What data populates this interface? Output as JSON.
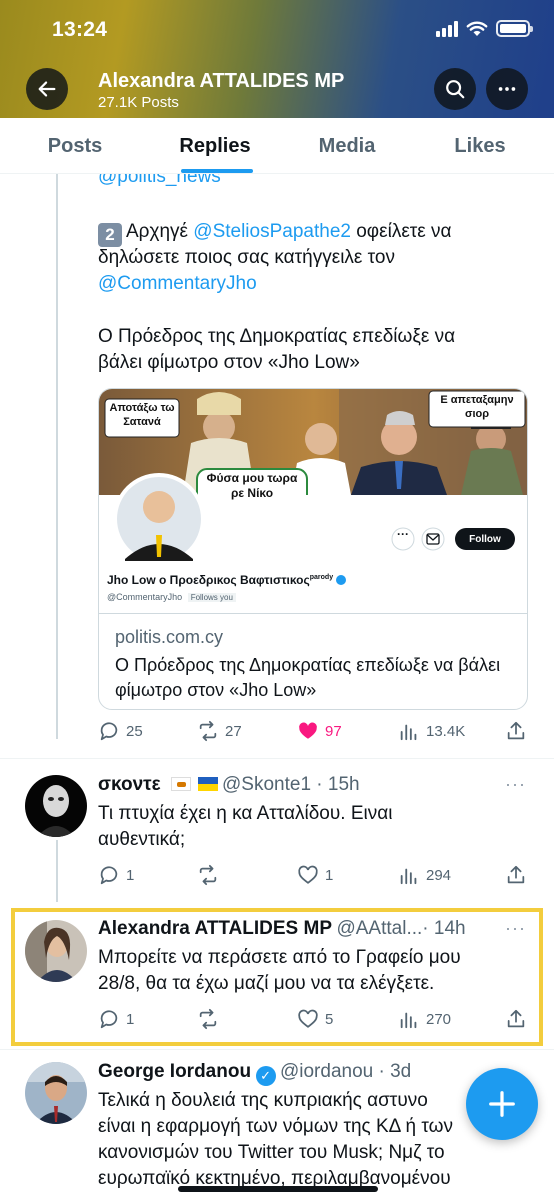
{
  "status_bar": {
    "time": "13:24"
  },
  "header": {
    "name": "Alexandra ATTALIDES MP",
    "posts": "27.1K Posts"
  },
  "tabs": [
    {
      "label": "Posts"
    },
    {
      "label": "Replies"
    },
    {
      "label": "Media"
    },
    {
      "label": "Likes"
    }
  ],
  "active_tab": "Replies",
  "tweet1": {
    "cut_mention": "@politis_news",
    "line1_number": "2",
    "line1_prefix": "Αρχηγέ",
    "line1_mention": "@SteliosPapathe2",
    "line1_suffix": "οφείλετε να",
    "line2": "δηλώσετε ποιος σας κατήγγειλε τον",
    "line3_mention": "@CommentaryJho",
    "para2_line1": "Ο Πρόεδρος της Δημοκρατίας επεδίωξε να",
    "para2_line2": "βάλει φίμωτρο στον «Jho Low»",
    "card": {
      "meme_text_left": "Αποτάξω τω Σατανά",
      "meme_text_center": "Φύσα μου τωρα ρε Νίκο",
      "meme_text_right": "Ε απεταξαμην σιορ",
      "profile_name": "Jho Low ο Προεδρικος Βαφτιστικος",
      "parody_label": "parody",
      "profile_handle": "@CommentaryJho",
      "follows_you": "Follows you",
      "follow_button": "Follow",
      "domain": "politis.com.cy",
      "title": "Ο Πρόεδρος της Δημοκρατίας επεδίωξε να βάλει φίμωτρο στον «Jho Low»"
    },
    "stats": {
      "replies": "25",
      "retweets": "27",
      "likes": "97",
      "views": "13.4K"
    }
  },
  "tweet2": {
    "name": "σκοντε",
    "handle_time": "@Skonte1 · 15h",
    "text_line1": "Τι πτυχία έχει η κα Ατταλίδου. Ειναι",
    "text_line2": "αυθεντικά;",
    "stats": {
      "replies": "1",
      "retweets": "",
      "likes": "1",
      "views": "294"
    }
  },
  "tweet3": {
    "name": "Alexandra ATTALIDES MP",
    "handle": "@AAttal...",
    "time": "· 14h",
    "text_line1": "Μπορείτε να περάσετε από το Γραφείο μου",
    "text_line2": "28/8, θα τα έχω μαζί μου να τα ελέγξετε.",
    "stats": {
      "replies": "1",
      "retweets": "",
      "likes": "5",
      "views": "270"
    }
  },
  "tweet4": {
    "name": "George Iordanou",
    "handle_time": "@iordanou · 3d",
    "text_line1": "Τελικά η δουλειά της κυπριακής αστυνο",
    "text_line2": "είναι η εφαρμογή των νόμων της ΚΔ ή των",
    "text_line3": "κανονισμών του Twitter του Musk; Νμζ το",
    "text_line4": "ευρωπαϊκό κεκτημένο, περιλαμβανομένου"
  },
  "colors": {
    "accent": "#1d9bf0",
    "like": "#f91880",
    "highlight": "#f3cd3d",
    "secondary_text": "#536471"
  }
}
